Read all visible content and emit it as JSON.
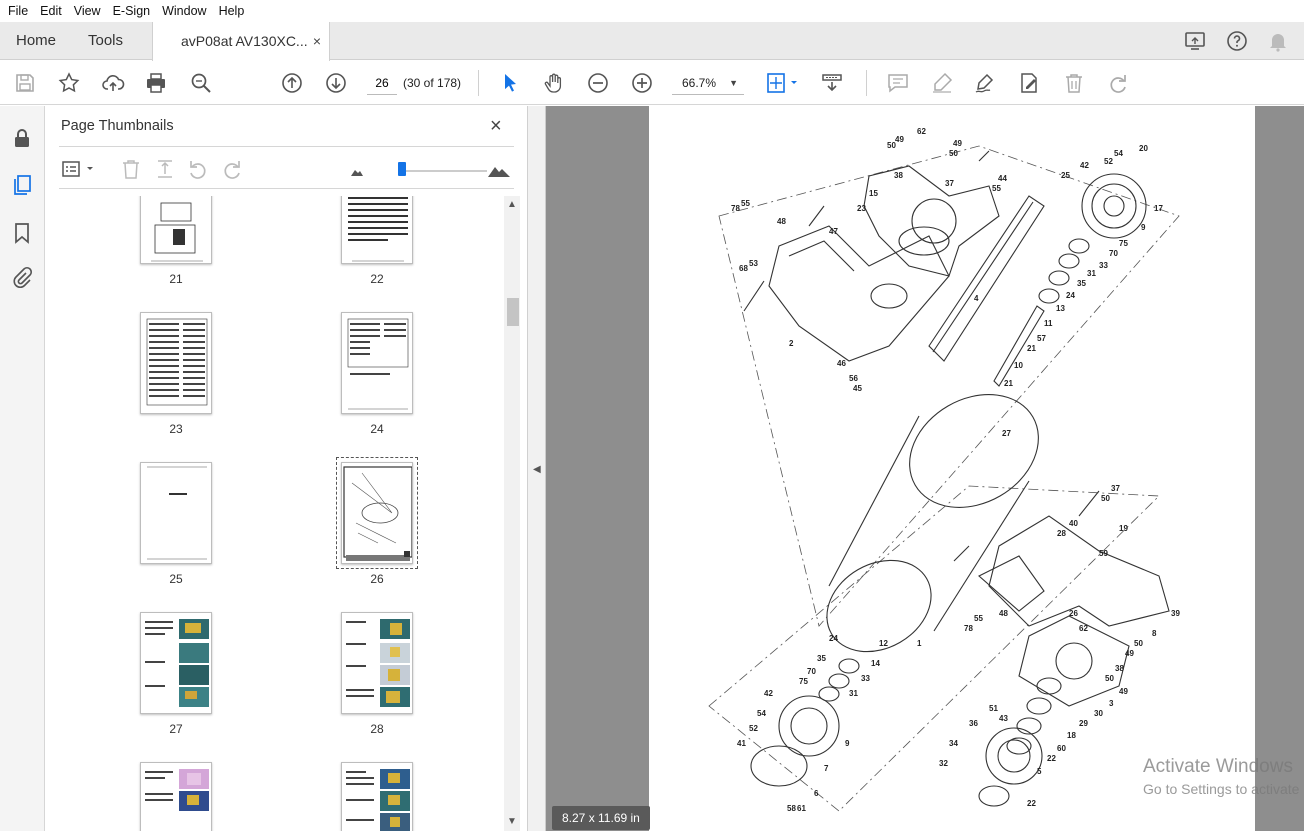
{
  "menu": [
    "File",
    "Edit",
    "View",
    "E-Sign",
    "Window",
    "Help"
  ],
  "tabs": {
    "home": "Home",
    "tools": "Tools",
    "document": "avP08at AV130XC...",
    "close": "×"
  },
  "toolbar": {
    "page_number": "26",
    "page_count": "(30 of 178)",
    "zoom": "66.7%"
  },
  "panel": {
    "title": "Page Thumbnails",
    "close": "×",
    "thumbnails": [
      {
        "label": "21"
      },
      {
        "label": "22"
      },
      {
        "label": "23"
      },
      {
        "label": "24"
      },
      {
        "label": "25"
      },
      {
        "label": "26"
      },
      {
        "label": "27"
      },
      {
        "label": "28"
      }
    ]
  },
  "document": {
    "page_size": "8.27 x 11.69 in"
  },
  "watermark": {
    "line1": "Activate Windows",
    "line2": "Go to Settings to activate"
  },
  "colors": {
    "accent": "#1473e6",
    "doc_background": "#8e8e8e",
    "tab_bar": "#eaeaea"
  }
}
